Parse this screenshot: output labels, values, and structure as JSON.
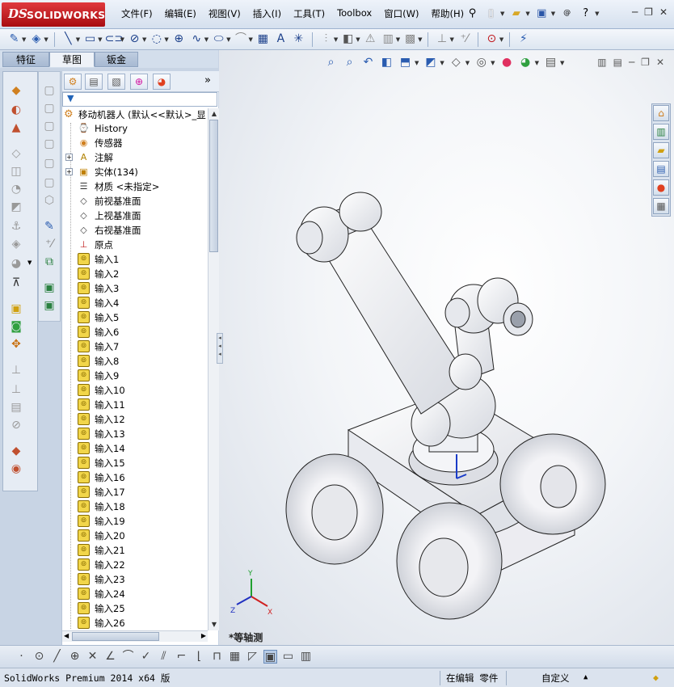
{
  "app": {
    "brand_ds": "DS",
    "brand_name": "SOLIDWORKS"
  },
  "menu": [
    "文件(F)",
    "编辑(E)",
    "视图(V)",
    "插入(I)",
    "工具(T)",
    "Toolbox",
    "窗口(W)",
    "帮助(H)"
  ],
  "tabs": [
    "特征",
    "草图",
    "钣金"
  ],
  "active_tab": "草图",
  "tree": {
    "root": "移动机器人  (默认<<默认>_显",
    "nodes": [
      {
        "label": "History",
        "icon": "history-icon",
        "expandable": false
      },
      {
        "label": "传感器",
        "icon": "sensor-icon",
        "expandable": false
      },
      {
        "label": "注解",
        "icon": "annotation-icon",
        "expandable": true
      },
      {
        "label": "实体(134)",
        "icon": "solid-body-icon",
        "expandable": true
      },
      {
        "label": "材质 <未指定>",
        "icon": "material-icon",
        "expandable": false
      },
      {
        "label": "前视基准面",
        "icon": "plane-icon",
        "expandable": false
      },
      {
        "label": "上视基准面",
        "icon": "plane-icon",
        "expandable": false
      },
      {
        "label": "右视基准面",
        "icon": "plane-icon",
        "expandable": false
      },
      {
        "label": "原点",
        "icon": "origin-icon",
        "expandable": false
      },
      {
        "label": "输入1",
        "icon": "imported-body-icon",
        "expandable": false
      },
      {
        "label": "输入2",
        "icon": "imported-body-icon",
        "expandable": false
      },
      {
        "label": "输入3",
        "icon": "imported-body-icon",
        "expandable": false
      },
      {
        "label": "输入4",
        "icon": "imported-body-icon",
        "expandable": false
      },
      {
        "label": "输入5",
        "icon": "imported-body-icon",
        "expandable": false
      },
      {
        "label": "输入6",
        "icon": "imported-body-icon",
        "expandable": false
      },
      {
        "label": "输入7",
        "icon": "imported-body-icon",
        "expandable": false
      },
      {
        "label": "输入8",
        "icon": "imported-body-icon",
        "expandable": false
      },
      {
        "label": "输入9",
        "icon": "imported-body-icon",
        "expandable": false
      },
      {
        "label": "输入10",
        "icon": "imported-body-icon",
        "expandable": false
      },
      {
        "label": "输入11",
        "icon": "imported-body-icon",
        "expandable": false
      },
      {
        "label": "输入12",
        "icon": "imported-body-icon",
        "expandable": false
      },
      {
        "label": "输入13",
        "icon": "imported-body-icon",
        "expandable": false
      },
      {
        "label": "输入14",
        "icon": "imported-body-icon",
        "expandable": false
      },
      {
        "label": "输入15",
        "icon": "imported-body-icon",
        "expandable": false
      },
      {
        "label": "输入16",
        "icon": "imported-body-icon",
        "expandable": false
      },
      {
        "label": "输入17",
        "icon": "imported-body-icon",
        "expandable": false
      },
      {
        "label": "输入18",
        "icon": "imported-body-icon",
        "expandable": false
      },
      {
        "label": "输入19",
        "icon": "imported-body-icon",
        "expandable": false
      },
      {
        "label": "输入20",
        "icon": "imported-body-icon",
        "expandable": false
      },
      {
        "label": "输入21",
        "icon": "imported-body-icon",
        "expandable": false
      },
      {
        "label": "输入22",
        "icon": "imported-body-icon",
        "expandable": false
      },
      {
        "label": "输入23",
        "icon": "imported-body-icon",
        "expandable": false
      },
      {
        "label": "输入24",
        "icon": "imported-body-icon",
        "expandable": false
      },
      {
        "label": "输入25",
        "icon": "imported-body-icon",
        "expandable": false
      },
      {
        "label": "输入26",
        "icon": "imported-body-icon",
        "expandable": false
      }
    ]
  },
  "viewport": {
    "view_label": "*等轴测",
    "triad": {
      "x": "X",
      "y": "Y",
      "z": "Z"
    }
  },
  "status": {
    "product": "SolidWorks Premium 2014 x64 版",
    "mode": "在编辑 零件",
    "units": "自定义"
  },
  "colors": {
    "brand_red": "#c0161b",
    "selection_blue": "#2264b8"
  }
}
